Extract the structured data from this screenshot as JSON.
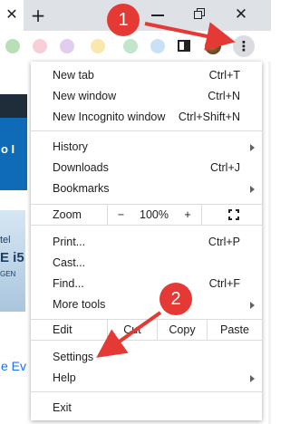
{
  "browser": {
    "tab_close_glyph": "✕",
    "new_tab_glyph": "+",
    "window_close_glyph": "✕",
    "menu_button_glyph": "⋮"
  },
  "page_background": {
    "blue_banner_text": "o I",
    "chip_brand": "tel",
    "chip_model": "E i5",
    "chip_gen": "GEN",
    "link_text": "e Ev"
  },
  "menu": {
    "new_tab": {
      "label": "New tab",
      "shortcut": "Ctrl+T"
    },
    "new_window": {
      "label": "New window",
      "shortcut": "Ctrl+N"
    },
    "new_incognito": {
      "label": "New Incognito window",
      "shortcut": "Ctrl+Shift+N"
    },
    "history": {
      "label": "History"
    },
    "downloads": {
      "label": "Downloads",
      "shortcut": "Ctrl+J"
    },
    "bookmarks": {
      "label": "Bookmarks"
    },
    "zoom": {
      "label": "Zoom",
      "minus": "−",
      "value": "100%",
      "plus": "+"
    },
    "print": {
      "label": "Print...",
      "shortcut": "Ctrl+P"
    },
    "cast": {
      "label": "Cast..."
    },
    "find": {
      "label": "Find...",
      "shortcut": "Ctrl+F"
    },
    "more_tools": {
      "label": "More tools"
    },
    "edit": {
      "label": "Edit",
      "cut": "Cut",
      "copy": "Copy",
      "paste": "Paste"
    },
    "settings": {
      "label": "Settings"
    },
    "help": {
      "label": "Help"
    },
    "exit": {
      "label": "Exit"
    }
  },
  "annotations": {
    "step1": "1",
    "step2": "2",
    "color": "#e53935"
  },
  "colors": {
    "toolbar_bg": "#dee1e6",
    "menu_border": "#dadce0",
    "text": "#202124"
  }
}
